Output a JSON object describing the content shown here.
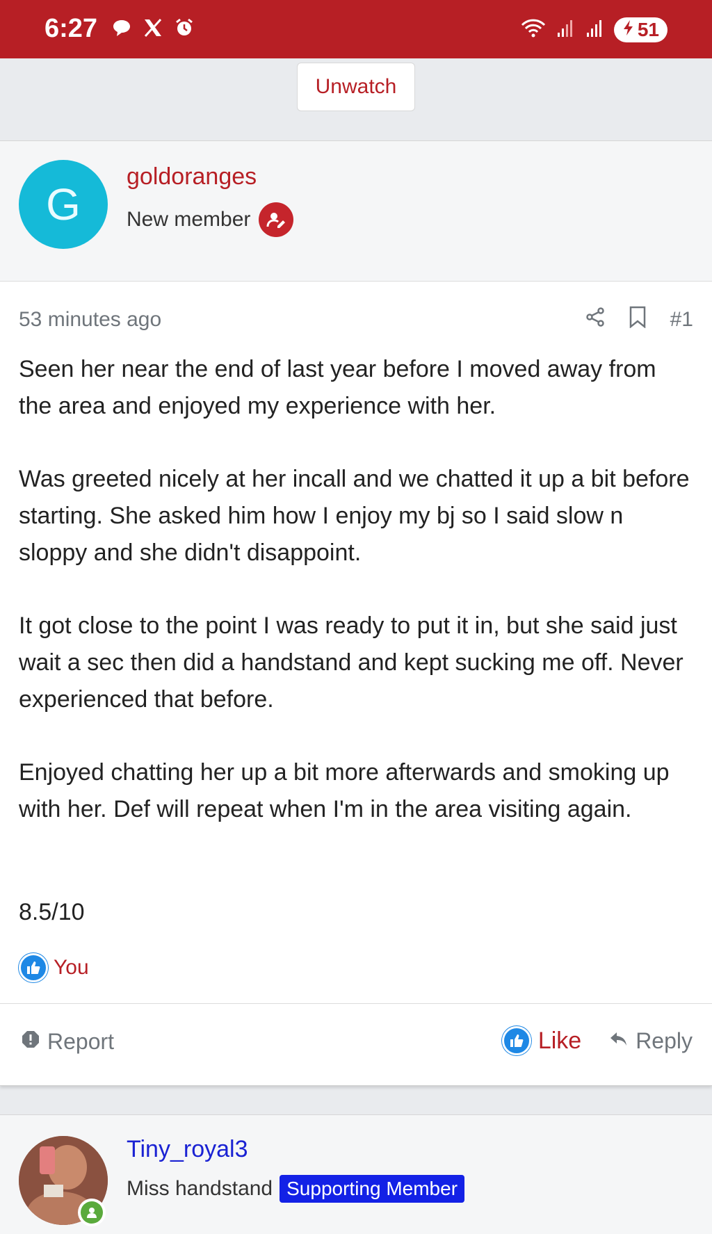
{
  "status_bar": {
    "time": "6:27",
    "left_icons": [
      "chat-bubble-icon",
      "x-logo-icon",
      "alarm-icon"
    ],
    "right_icons": [
      "wifi-icon",
      "signal-icon",
      "signal-icon"
    ],
    "battery": "51"
  },
  "thread_actions": {
    "unwatch_label": "Unwatch"
  },
  "post": {
    "avatar_letter": "G",
    "username": "goldoranges",
    "user_title": "New member",
    "time_ago": "53 minutes ago",
    "post_number": "#1",
    "paragraphs": [
      "Seen her near the end of last year before I moved away from the area and enjoyed my experience with her.",
      "Was greeted nicely at her incall and we chatted it up a bit before starting. She asked him how I enjoy my bj so I said slow n sloppy and she didn't disappoint.",
      "It got close to the point I was ready to put it in, but she said just wait a sec then did a handstand and kept sucking me off. Never experienced that before.",
      "Enjoyed chatting her up a bit more afterwards and smoking up with her. Def will repeat when I'm in the area visiting again."
    ],
    "rating": "8.5/10",
    "liked_by": "You",
    "report_label": "Report",
    "like_label": "Like",
    "reply_label": "Reply"
  },
  "next_post": {
    "username": "Tiny_royal3",
    "user_title": "Miss handstand",
    "badge": "Supporting Member"
  },
  "colors": {
    "brand": "#b71f25",
    "avatar_bg": "#15bad8",
    "like_blue": "#1e88e5",
    "supporting_badge": "#1321e6",
    "online_green": "#5aaa3c"
  }
}
